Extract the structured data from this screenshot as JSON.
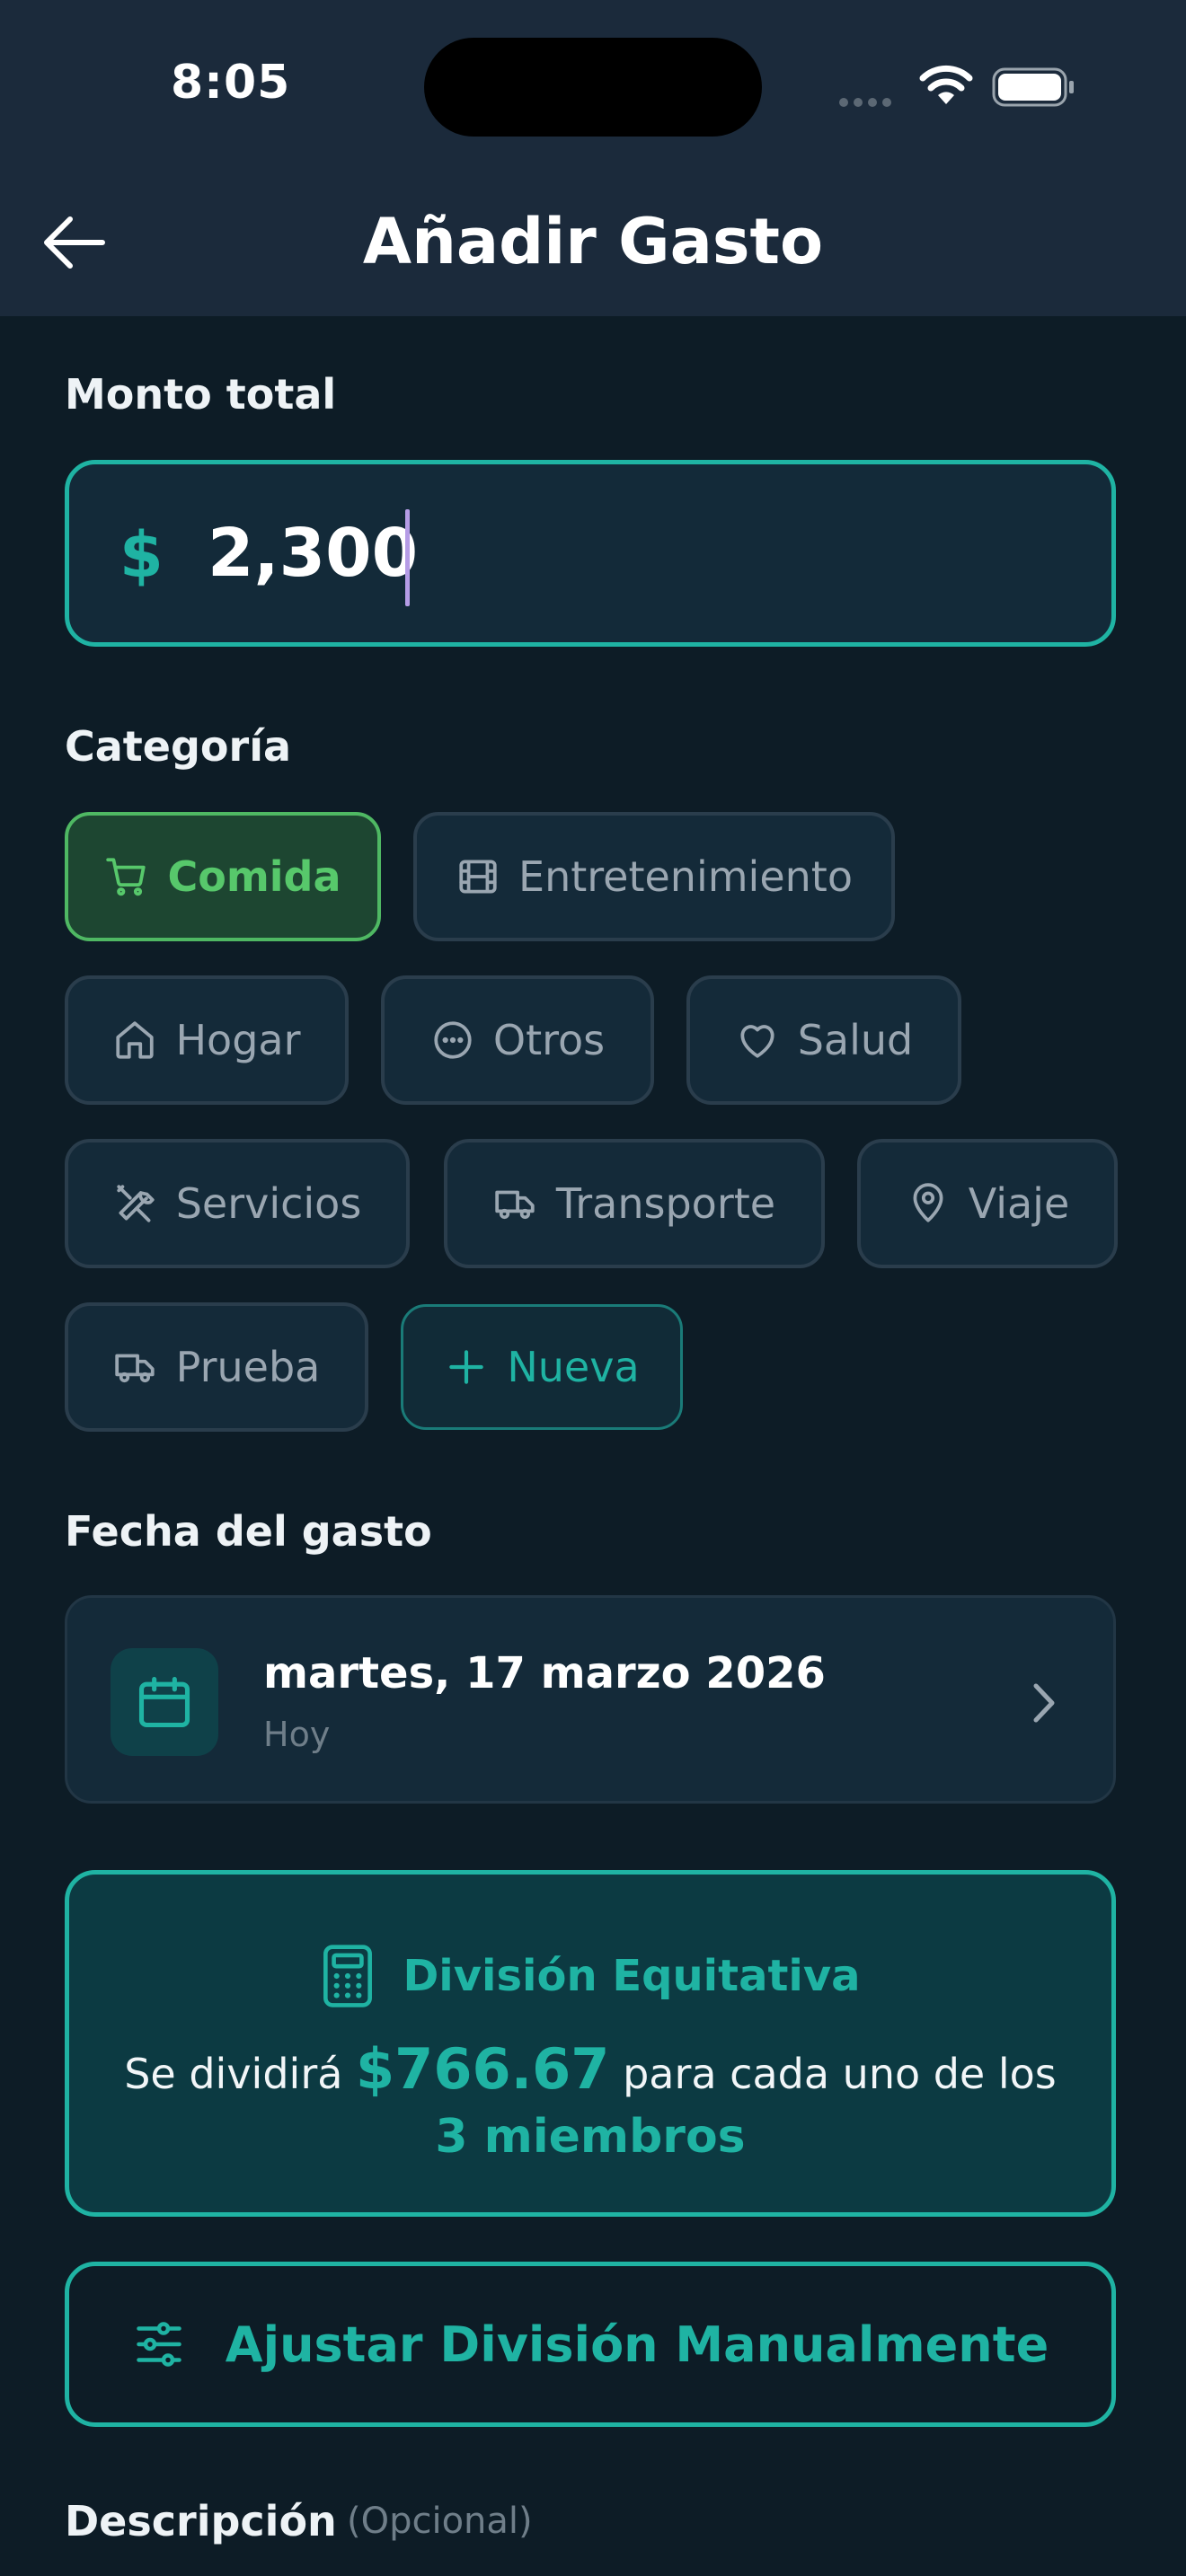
{
  "status_bar": {
    "time": "8:05"
  },
  "header": {
    "title": "Añadir Gasto",
    "back_icon": "arrow-left-icon"
  },
  "amount": {
    "label": "Monto total",
    "currency": "$",
    "value": "2,300"
  },
  "category": {
    "label": "Categoría",
    "chips": [
      {
        "label": "Comida",
        "icon": "cart-icon",
        "selected": true
      },
      {
        "label": "Entretenimiento",
        "icon": "film-icon",
        "selected": false
      },
      {
        "label": "Hogar",
        "icon": "home-icon",
        "selected": false
      },
      {
        "label": "Otros",
        "icon": "more-circle-icon",
        "selected": false
      },
      {
        "label": "Salud",
        "icon": "heart-icon",
        "selected": false
      },
      {
        "label": "Servicios",
        "icon": "tools-icon",
        "selected": false
      },
      {
        "label": "Transporte",
        "icon": "truck-icon",
        "selected": false
      },
      {
        "label": "Viaje",
        "icon": "map-pin-icon",
        "selected": false
      },
      {
        "label": "Prueba",
        "icon": "truck-icon",
        "selected": false
      }
    ],
    "new_label": "Nueva"
  },
  "date": {
    "label": "Fecha del gasto",
    "value": "martes, 17 marzo 2026",
    "sub": "Hoy"
  },
  "split": {
    "title": "División Equitativa",
    "text_before": "Se dividirá",
    "amount": "$766.67",
    "text_after": "para cada uno de los",
    "members": "3 miembros"
  },
  "manual_button": {
    "label": "Ajustar División Manualmente"
  },
  "description": {
    "label": "Descripción",
    "optional": "(Opcional)"
  },
  "colors": {
    "accent": "#1fb3a3",
    "selected": "#57c86b",
    "background": "#0d1c26"
  }
}
